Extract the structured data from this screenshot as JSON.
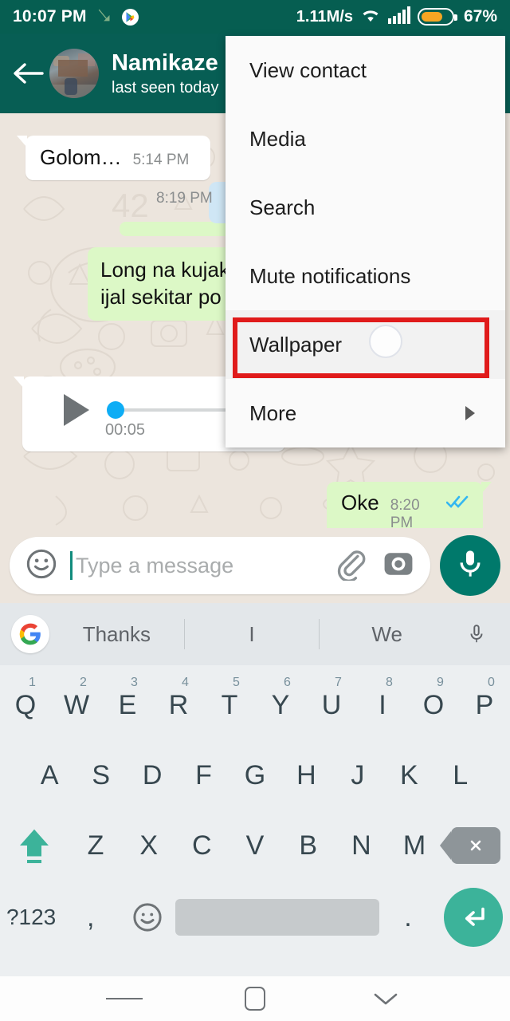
{
  "status_bar": {
    "time": "10:07 PM",
    "network_speed": "1.11M/s",
    "battery_percent": "67%",
    "icons": [
      "call-forward-icon",
      "play-store-icon",
      "wifi-icon",
      "signal-icon",
      "battery-icon"
    ]
  },
  "app_bar": {
    "back_icon": "back-arrow-icon",
    "avatar": "contact-avatar",
    "contact_name": "Namikaze",
    "contact_status": "last seen today"
  },
  "menu": {
    "items": [
      {
        "label": "View contact",
        "has_submenu": false,
        "highlighted": false
      },
      {
        "label": "Media",
        "has_submenu": false,
        "highlighted": false
      },
      {
        "label": "Search",
        "has_submenu": false,
        "highlighted": false
      },
      {
        "label": "Mute notifications",
        "has_submenu": false,
        "highlighted": false
      },
      {
        "label": "Wallpaper",
        "has_submenu": false,
        "highlighted": true
      },
      {
        "label": "More",
        "has_submenu": true,
        "highlighted": false
      }
    ],
    "highlight_color": "#e01b1b"
  },
  "chat": {
    "background_color": "#ece5dd",
    "messages": [
      {
        "type": "incoming",
        "text": "Golom…",
        "time": "5:14 PM"
      },
      {
        "type": "outgoing",
        "line1": "Long na kujak",
        "line2": "ijal sekitar po"
      },
      {
        "type": "voice_outgoing",
        "duration": "00:05",
        "time": "8:19 PM",
        "play_icon": "play-icon"
      },
      {
        "type": "outgoing",
        "text": "Oke",
        "time": "8:20 PM",
        "status": "read-double-check"
      }
    ]
  },
  "input_bar": {
    "emoji_icon": "emoji-icon",
    "placeholder": "Type a message",
    "value": "",
    "attach_icon": "paperclip-icon",
    "camera_icon": "camera-icon",
    "mic_icon": "microphone-icon",
    "mic_button_color": "#00796b"
  },
  "keyboard": {
    "suggestions": [
      "Thanks",
      "I",
      "We"
    ],
    "google_icon": "google-logo-icon",
    "voice_icon": "microphone-icon",
    "row1": [
      {
        "letter": "Q",
        "num": "1"
      },
      {
        "letter": "W",
        "num": "2"
      },
      {
        "letter": "E",
        "num": "3"
      },
      {
        "letter": "R",
        "num": "4"
      },
      {
        "letter": "T",
        "num": "5"
      },
      {
        "letter": "Y",
        "num": "6"
      },
      {
        "letter": "U",
        "num": "7"
      },
      {
        "letter": "I",
        "num": "8"
      },
      {
        "letter": "O",
        "num": "9"
      },
      {
        "letter": "P",
        "num": "0"
      }
    ],
    "row2": [
      "A",
      "S",
      "D",
      "F",
      "G",
      "H",
      "J",
      "K",
      "L"
    ],
    "row3": [
      "Z",
      "X",
      "C",
      "V",
      "B",
      "N",
      "M"
    ],
    "shift_icon": "shift-icon",
    "backspace_icon": "backspace-icon",
    "symbols_key": "?123",
    "comma_key": ",",
    "emoji_key_icon": "emoji-icon",
    "period_key": ".",
    "enter_icon": "enter-icon",
    "enter_color": "#3cb39a"
  },
  "nav_bar": {
    "recents_icon": "recents-icon",
    "home_icon": "home-icon",
    "back_icon": "chevron-down-icon"
  }
}
